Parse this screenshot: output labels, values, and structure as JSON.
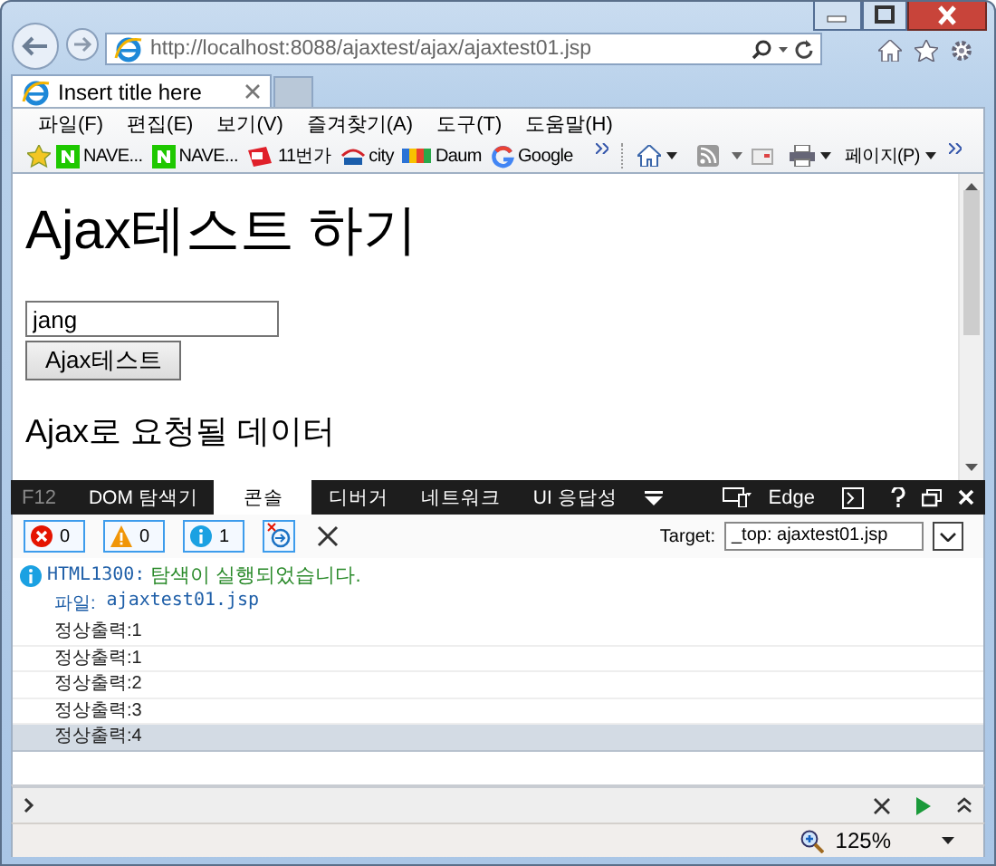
{
  "browser": {
    "address": "http://localhost:8088/ajaxtest/ajax/ajaxtest01.jsp",
    "tabs": [
      {
        "title": "Insert title here",
        "selected": true
      }
    ],
    "menu": [
      "파일(F)",
      "편집(E)",
      "보기(V)",
      "즐겨찾기(A)",
      "도구(T)",
      "도움말(H)"
    ],
    "favorites": [
      {
        "label": "NAVE...",
        "kind": "naver"
      },
      {
        "label": "NAVE...",
        "kind": "naver"
      },
      {
        "label": "11번가",
        "kind": "shop"
      },
      {
        "label": "city",
        "kind": "citi"
      },
      {
        "label": "Daum",
        "kind": "daum"
      },
      {
        "label": "Google",
        "kind": "google"
      }
    ],
    "page_menu": "페이지(P)"
  },
  "page": {
    "heading": "Ajax테스트 하기",
    "input": {
      "value": "jang"
    },
    "button": "Ajax테스트",
    "result_heading": "Ajax로 요청될 데이터"
  },
  "devtools": {
    "label": "F12",
    "tabs": [
      {
        "label": "DOM 탐색기",
        "selected": false
      },
      {
        "label": "콘솔",
        "selected": true
      },
      {
        "label": "디버거",
        "selected": false
      },
      {
        "label": "네트워크",
        "selected": false
      },
      {
        "label": "UI 응답성",
        "selected": false
      }
    ],
    "mode": "Edge",
    "counters": [
      {
        "kind": "error",
        "count": "0"
      },
      {
        "kind": "warning",
        "count": "0"
      },
      {
        "kind": "info",
        "count": "1"
      }
    ],
    "target_label": "Target:",
    "target": "_top: ajaxtest01.jsp",
    "messages": [
      {
        "kind": "info",
        "code": "HTML1300:",
        "text": "탐색이 실행되었습니다.",
        "file_label": "파일:",
        "file": "ajaxtest01.jsp"
      }
    ],
    "logs": [
      {
        "text": "정상출력:1",
        "selected": false
      },
      {
        "text": "정상출력:1",
        "selected": false
      },
      {
        "text": "정상출력:2",
        "selected": false
      },
      {
        "text": "정상출력:3",
        "selected": false
      },
      {
        "text": "정상출력:4",
        "selected": true
      }
    ]
  },
  "status_bar": {
    "zoom": "125%"
  }
}
